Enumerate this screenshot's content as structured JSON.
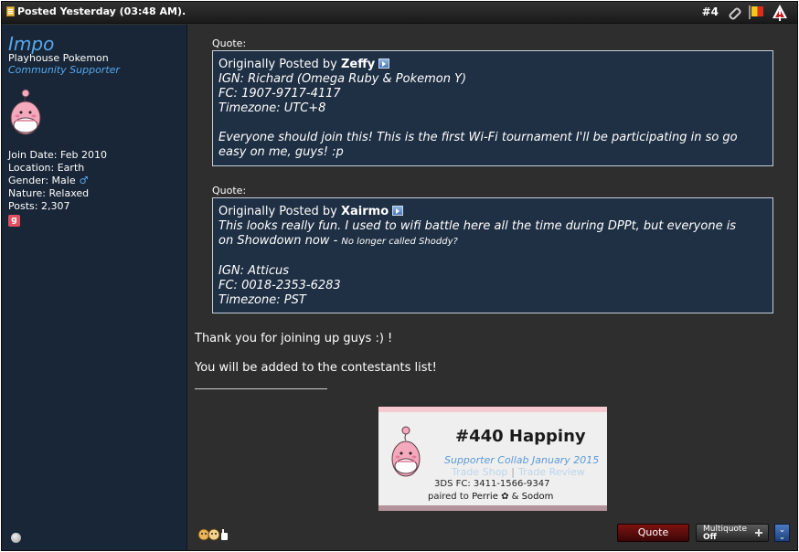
{
  "header": {
    "date_text": "Posted Yesterday (03:48 AM).",
    "post_number": "#4"
  },
  "user": {
    "name": "Impo",
    "title": "Playhouse Pokemon",
    "rank": "Community Supporter",
    "join_date": "Join Date: Feb 2010",
    "location": "Location: Earth",
    "gender": "Gender: Male",
    "gender_symbol": "♂",
    "nature": "Nature: Relaxed",
    "posts": "Posts: 2,307",
    "gplus_glyph": "g"
  },
  "quotes": [
    {
      "label": "Quote:",
      "prefix": "Originally Posted by",
      "author": "Zeffy",
      "lines": [
        "IGN: Richard (Omega Ruby & Pokemon Y)",
        "FC: 1907-9717-4117",
        "Timezone: UTC+8",
        "",
        "Everyone should join this! This is the first Wi-Fi tournament I'll be participating in so go",
        "easy on me, guys! :p"
      ]
    },
    {
      "label": "Quote:",
      "prefix": "Originally Posted by",
      "author": "Xairmo",
      "line1": "This looks really fun. I used to wifi battle here all the time during DPPt, but everyone is",
      "line2_main": "on Showdown now - ",
      "line2_small": "No longer called Shoddy?",
      "lines_after": [
        "",
        "IGN: Atticus",
        "FC: 0018-2353-6283",
        "Timezone: PST"
      ]
    }
  ],
  "message": {
    "line1": "Thank you for joining up guys :) !",
    "line2": "You will be added to the contestants list!"
  },
  "signature": {
    "title": "#440 Happiny",
    "collab": "Supporter Collab January 2015",
    "link1": "Trade Shop",
    "link_sep": "|",
    "link2": "Trade Review",
    "fc": "3DS FC: 3411-1566-9347",
    "paired_prefix": "paired to",
    "paired_name1": "Perrie",
    "paired_flower": "✿",
    "paired_amp": "&",
    "paired_name2": "Sodom"
  },
  "footer": {
    "quote_label": "Quote",
    "multiquote_label": "Multiquote",
    "multiquote_state": "Off",
    "expand_glyph": "⌄"
  },
  "colors": {
    "header_bg": "#1f1f1f",
    "sidebar_bg": "#182637",
    "content_bg": "#2e2e2e",
    "quote_bg": "#1f2f44",
    "link_blue": "#57a8ee",
    "quote_button": "#6a0e0e"
  },
  "icons": [
    "doc-icon",
    "link-icon",
    "flag-icon",
    "warning-icon",
    "male-icon",
    "gplus-icon",
    "arrow-icon",
    "online-status-icon",
    "reputation-icon",
    "expand-icon"
  ]
}
